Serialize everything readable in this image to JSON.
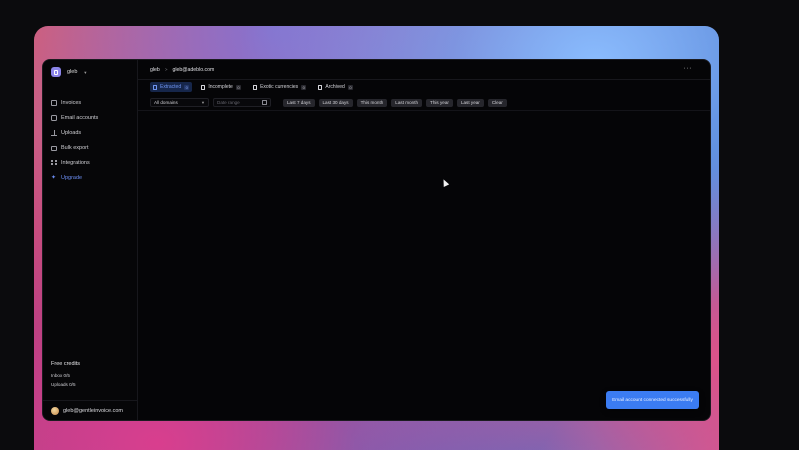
{
  "workspace": {
    "name": "gleb",
    "chevron_icon": "chevron-down-icon"
  },
  "sidebar": {
    "items": [
      {
        "label": "Invoices",
        "icon": "document-icon"
      },
      {
        "label": "Email accounts",
        "icon": "mail-icon"
      },
      {
        "label": "Uploads",
        "icon": "upload-icon"
      },
      {
        "label": "Bulk export",
        "icon": "folder-icon"
      },
      {
        "label": "Integrations",
        "icon": "grid-icon"
      },
      {
        "label": "Upgrade",
        "icon": "sparkle-icon",
        "color": "#6b8cf0"
      }
    ]
  },
  "credits": {
    "title": "Free credits",
    "inbox": "Inbox 0/5",
    "uploads": "Uploads 0/5"
  },
  "user": {
    "email": "gleb@gentleinvoice.com"
  },
  "breadcrumb": {
    "first": "gleb",
    "separator": ">",
    "second": "gleb@adeblo.com"
  },
  "tabs": [
    {
      "label": "Extracted",
      "count": "0",
      "active": true
    },
    {
      "label": "Incomplete",
      "count": "0",
      "active": false
    },
    {
      "label": "Exotic currencies",
      "count": "0",
      "active": false
    },
    {
      "label": "Archived",
      "count": "0",
      "active": false
    }
  ],
  "filters": {
    "domain_select": "All domains",
    "date_placeholder": "Date range",
    "chips": [
      "Last 7 days",
      "Last 30 days",
      "This month",
      "Last month",
      "This year",
      "Last year",
      "Clear"
    ]
  },
  "toast": {
    "message": "Email account connected successfully"
  },
  "colors": {
    "accent": "#3b7cf2",
    "active_tab_text": "#6f95f2",
    "upgrade": "#6b8cf0"
  }
}
